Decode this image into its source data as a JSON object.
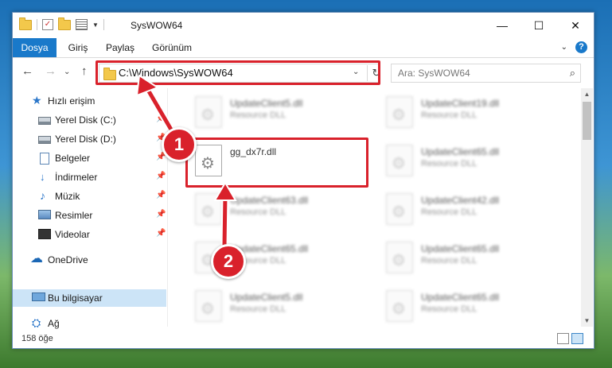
{
  "window": {
    "title": "SysWOW64",
    "controls": {
      "minimize": "—",
      "maximize": "☐",
      "close": "✕"
    }
  },
  "ribbon": {
    "tabs": [
      "Dosya",
      "Giriş",
      "Paylaş",
      "Görünüm"
    ],
    "expand": "⌄",
    "help": "?"
  },
  "navigation": {
    "back": "←",
    "forward": "→",
    "recent": "⌄",
    "up": "↑",
    "address": "C:\\Windows\\SysWOW64",
    "address_dropdown": "⌄",
    "refresh": "↻",
    "search_placeholder": "Ara: SysWOW64",
    "search_icon": "⌕"
  },
  "sidebar": {
    "items": [
      {
        "label": "Hızlı erişim",
        "icon": "star-icon",
        "glyph": "★"
      },
      {
        "label": "Yerel Disk (C:)",
        "icon": "drive-icon",
        "glyph": "",
        "pinned": true
      },
      {
        "label": "Yerel Disk (D:)",
        "icon": "drive-icon",
        "glyph": "",
        "pinned": true
      },
      {
        "label": "Belgeler",
        "icon": "document-icon",
        "glyph": "",
        "pinned": true
      },
      {
        "label": "İndirmeler",
        "icon": "download-icon",
        "glyph": "↓",
        "pinned": true
      },
      {
        "label": "Müzik",
        "icon": "music-icon",
        "glyph": "♪",
        "pinned": true
      },
      {
        "label": "Resimler",
        "icon": "pictures-icon",
        "glyph": "",
        "pinned": true
      },
      {
        "label": "Videolar",
        "icon": "video-icon",
        "glyph": "",
        "pinned": true
      },
      {
        "label": "OneDrive",
        "icon": "cloud-icon",
        "glyph": "☁"
      },
      {
        "label": "Bu bilgisayar",
        "icon": "computer-icon",
        "glyph": "",
        "selected": true
      },
      {
        "label": "Ağ",
        "icon": "network-icon",
        "glyph": "⛭"
      }
    ],
    "pin_glyph": "📌"
  },
  "files": [
    {
      "name": "UpdateClient5.dll",
      "type": "Resource DLL"
    },
    {
      "name": "UpdateClient19.dll",
      "type": "Resource DLL"
    },
    {
      "name": "gg_dx7r.dll",
      "type": ""
    },
    {
      "name": "UpdateClient65.dll",
      "type": "Resource DLL"
    },
    {
      "name": "UpdateClient63.dll",
      "type": "Resource DLL"
    },
    {
      "name": "UpdateClient42.dll",
      "type": "Resource DLL"
    },
    {
      "name": "UpdateClient65.dll",
      "type": "Resource DLL"
    },
    {
      "name": "UpdateClient65.dll",
      "type": "Resource DLL"
    },
    {
      "name": "UpdateClient5.dll",
      "type": "Resource DLL"
    },
    {
      "name": "UpdateClient65.dll",
      "type": "Resource DLL"
    }
  ],
  "status": {
    "item_count": "158 öğe"
  },
  "annotations": {
    "step1": "1",
    "step2": "2",
    "highlight_color": "#d9212b"
  },
  "scrollbar": {
    "up": "▲",
    "down": "▼"
  }
}
